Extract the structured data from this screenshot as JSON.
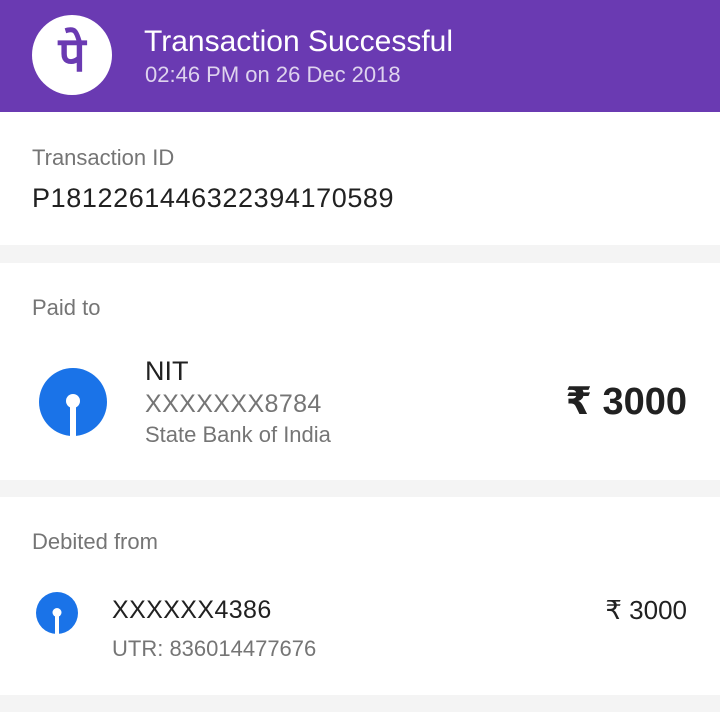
{
  "header": {
    "logo_glyph": "पे",
    "title": "Transaction Successful",
    "subtitle": "02:46 PM on 26 Dec 2018",
    "brand_color": "#6a3ab2"
  },
  "transaction": {
    "label": "Transaction ID",
    "value": "P1812261446322394170589"
  },
  "paid_to": {
    "label": "Paid to",
    "name": "NIT",
    "account": "XXXXXXX8784",
    "bank": "State Bank of India",
    "bank_icon": "sbi-logo-icon",
    "amount": "₹ 3000"
  },
  "debited_from": {
    "label": "Debited from",
    "account": "XXXXXX4386",
    "utr": "UTR: 836014477676",
    "bank_icon": "sbi-logo-icon",
    "amount": "₹ 3000"
  }
}
